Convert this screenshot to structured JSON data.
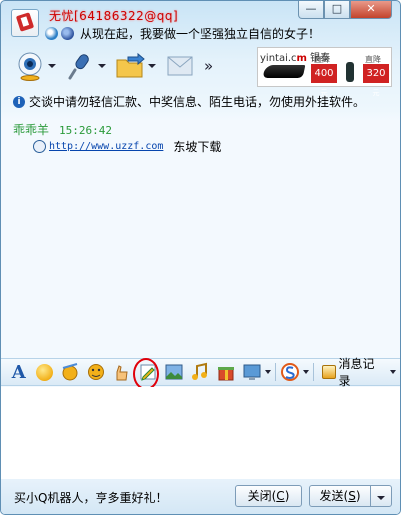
{
  "title": {
    "name": "无忧[64186322@qq]",
    "signature": "从现在起，我要做一个坚强独立自信的女子！",
    "minimize_label": "—",
    "maximize_label": "□",
    "close_label": "✕"
  },
  "toolbar": {
    "more_label": "»"
  },
  "ad_banner": {
    "brand_1": "yintai.c",
    "brand_2": "m",
    "brand_3": " 银泰",
    "label_1": "直降",
    "price_1": "400",
    "unit_1": "元",
    "label_2": "直降",
    "price_2": "320",
    "unit_2": "元"
  },
  "notice": "交谈中请勿轻信汇款、中奖信息、陌生电话，勿使用外挂软件。",
  "messages": [
    {
      "sender": "乖乖羊",
      "time": "15:26:42",
      "link": "http://www.uzzf.com",
      "text": "东坡下载"
    }
  ],
  "input_toolbar": {
    "history_label": "消息记录"
  },
  "input": {
    "value": ""
  },
  "footer": {
    "ad_text": "买小Q机器人，亨多重好礼！",
    "close_label": "关闭(",
    "close_key": "C",
    "close_end": ")",
    "send_label": "发送(",
    "send_key": "S",
    "send_end": ")"
  },
  "colors": {
    "highlight": "#e0000a",
    "sender": "#2a9a3a",
    "link": "#0645ad"
  }
}
